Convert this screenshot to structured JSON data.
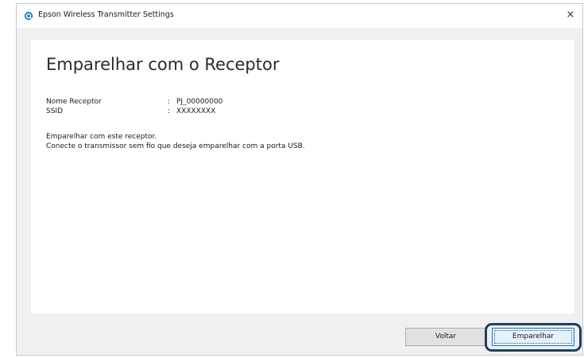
{
  "window": {
    "title": "Epson Wireless Transmitter Settings",
    "close_symbol": "×"
  },
  "page": {
    "heading": "Emparelhar com o Receptor",
    "info": [
      {
        "label": "Nome Receptor",
        "colon": ":",
        "value": "PJ_00000000"
      },
      {
        "label": "SSID",
        "colon": ":",
        "value": "XXXXXXXX"
      }
    ],
    "messages": [
      "Emparelhar com este receptor.",
      "Conecte o transmissor sem fio que deseja emparelhar com a porta USB."
    ]
  },
  "buttons": {
    "back_label": "Voltar",
    "pair_label": "Emparelhar"
  },
  "icons": {
    "app": "epson-settings-icon",
    "close": "close-icon"
  },
  "colors": {
    "highlight_outline": "#1d3f63",
    "primary_border": "#0078d7",
    "app_icon": "#1f7fd1"
  }
}
